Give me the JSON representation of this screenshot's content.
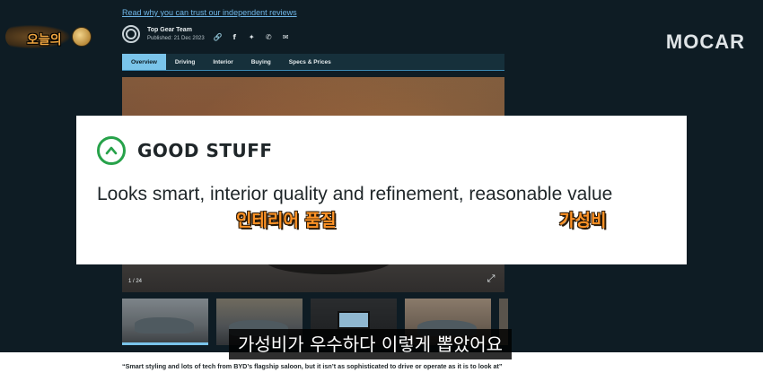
{
  "header": {
    "trust_link": "Read why you can trust our independent reviews",
    "author": "Top Gear Team",
    "published": "Published: 21 Dec 2023",
    "share_icons": [
      "link-icon",
      "facebook-icon",
      "twitter-icon",
      "whatsapp-icon",
      "email-icon"
    ]
  },
  "overlay_logos": {
    "channel_logo_text": "오늘의",
    "brand_logo": "MOCAR"
  },
  "tabs": [
    {
      "label": "Overview",
      "active": true
    },
    {
      "label": "Driving",
      "active": false
    },
    {
      "label": "Interior",
      "active": false
    },
    {
      "label": "Buying",
      "active": false
    },
    {
      "label": "Specs & Prices",
      "active": false
    }
  ],
  "gallery": {
    "counter": "1 / 24",
    "thumbnail_count_visible": 5
  },
  "good_stuff": {
    "heading": "GOOD STUFF",
    "text": "Looks smart, interior quality and refinement, reasonable value"
  },
  "annotations": {
    "interior_quality": "인테리어 품질",
    "value": "가성비"
  },
  "quote": "“Smart styling and lots of tech from BYD’s flagship saloon, but it isn’t as sophisticated to drive or operate as it is to look at”",
  "subtitle": "가성비가 우수하다 이렇게 뽑았어요",
  "colors": {
    "background": "#0e1c24",
    "tab_active": "#7ac4ea",
    "good_green": "#27a24a",
    "annotation_orange": "#ff9326"
  }
}
